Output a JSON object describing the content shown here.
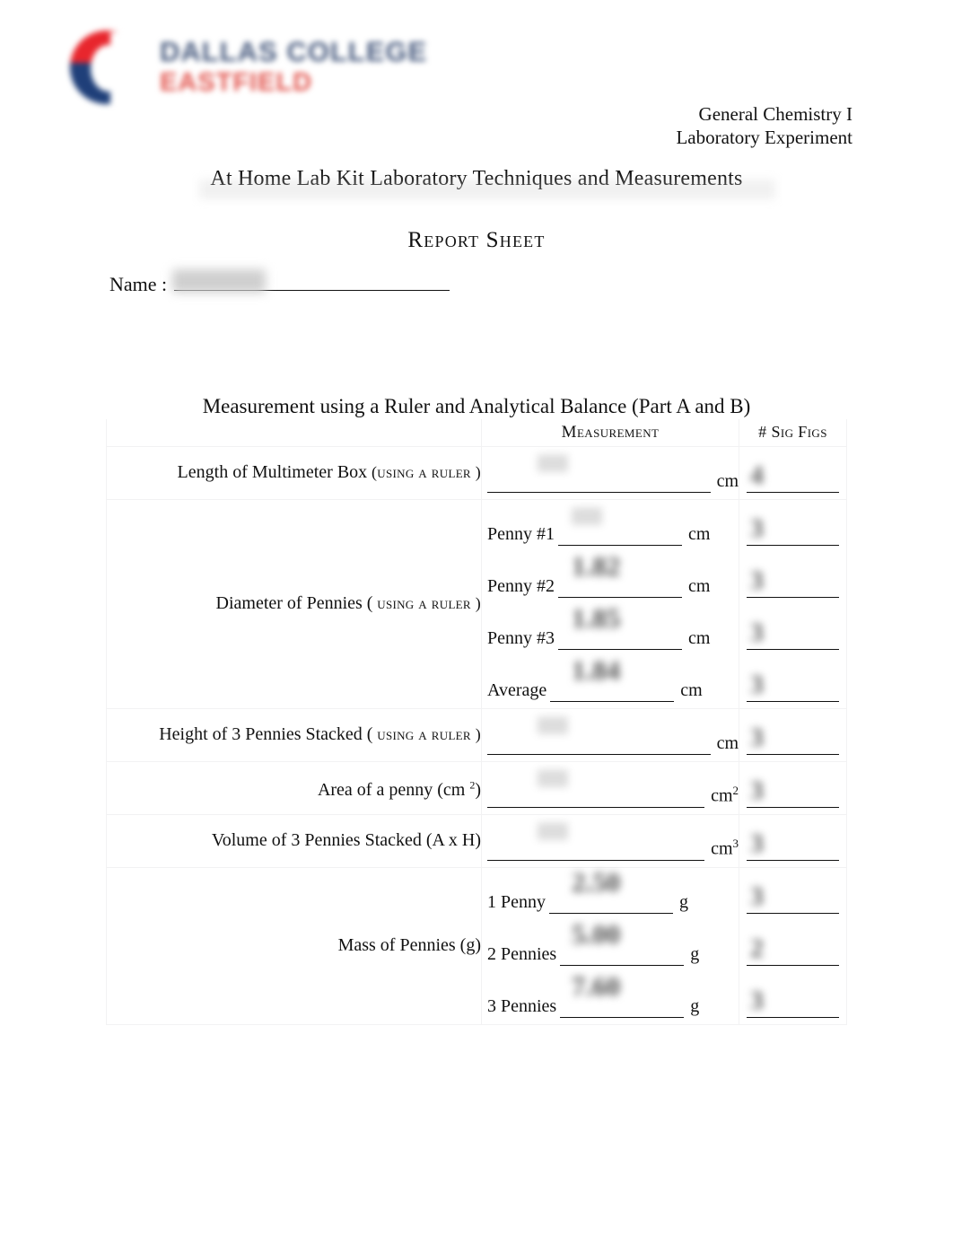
{
  "logo": {
    "mark_name": "dallas-college-shield",
    "line1": "DALLAS COLLEGE",
    "line2": "EASTFIELD",
    "color_red": "#e8262d",
    "color_blue": "#1f3f79"
  },
  "header": {
    "course": "General Chemistry I",
    "doc_kind": "Laboratory Experiment"
  },
  "titles": {
    "experiment": "At Home Lab Kit Laboratory Techniques and Measurements",
    "report_sheet": "Report  Sheet"
  },
  "name_field": {
    "label": "Name :",
    "value": ""
  },
  "section": {
    "heading": "Measurement using a Ruler and Analytical Balance (Part A and B)",
    "columns": {
      "label": "",
      "measurement": "Measurement",
      "sig_figs": "# Sig Figs"
    }
  },
  "rows": [
    {
      "label": "Length of Multimeter Box",
      "method": "(using a ruler  )",
      "lines": [
        {
          "prefix": "",
          "value": "",
          "unit": "cm",
          "sig": "4",
          "hand_class": "small"
        }
      ]
    },
    {
      "label": "Diameter of Pennies (",
      "method": "using a ruler  )",
      "lines": [
        {
          "prefix": "Penny #1",
          "value": "",
          "unit": "cm",
          "sig": "3",
          "hand_class": "small"
        },
        {
          "prefix": "Penny #2",
          "value": "1.82",
          "unit": "cm",
          "sig": "3",
          "hand_class": "big"
        },
        {
          "prefix": "Penny #3",
          "value": "1.85",
          "unit": "cm",
          "sig": "3",
          "hand_class": "big"
        },
        {
          "prefix": "Average",
          "value": "1.84",
          "unit": "cm",
          "sig": "3",
          "hand_class": "big"
        }
      ]
    },
    {
      "label": "Height of 3 Pennies Stacked (",
      "method": "using a ruler  )",
      "lines": [
        {
          "prefix": "",
          "value": "",
          "unit": "cm",
          "sig": "3",
          "hand_class": "small"
        }
      ]
    },
    {
      "label": "Area of a penny (cm",
      "method": "",
      "lines": [
        {
          "prefix": "",
          "value": "",
          "unit": "cm2",
          "sig": "3",
          "hand_class": "small"
        }
      ]
    },
    {
      "label": "Volume of 3 Pennies Stacked   (A x H)",
      "method": "",
      "lines": [
        {
          "prefix": "",
          "value": "",
          "unit": "cm3",
          "sig": "3",
          "hand_class": "small"
        }
      ]
    },
    {
      "label": "Mass of Pennies (g)",
      "method": "",
      "lines": [
        {
          "prefix": "1 Penny",
          "value": "2.50",
          "unit": "g",
          "sig": "3",
          "hand_class": "big"
        },
        {
          "prefix": "2 Pennies",
          "value": "5.00",
          "unit": "g",
          "sig": "2",
          "hand_class": "big"
        },
        {
          "prefix": "3 Pennies",
          "value": "7.60",
          "unit": "g",
          "sig": "3",
          "hand_class": "big"
        }
      ]
    }
  ]
}
